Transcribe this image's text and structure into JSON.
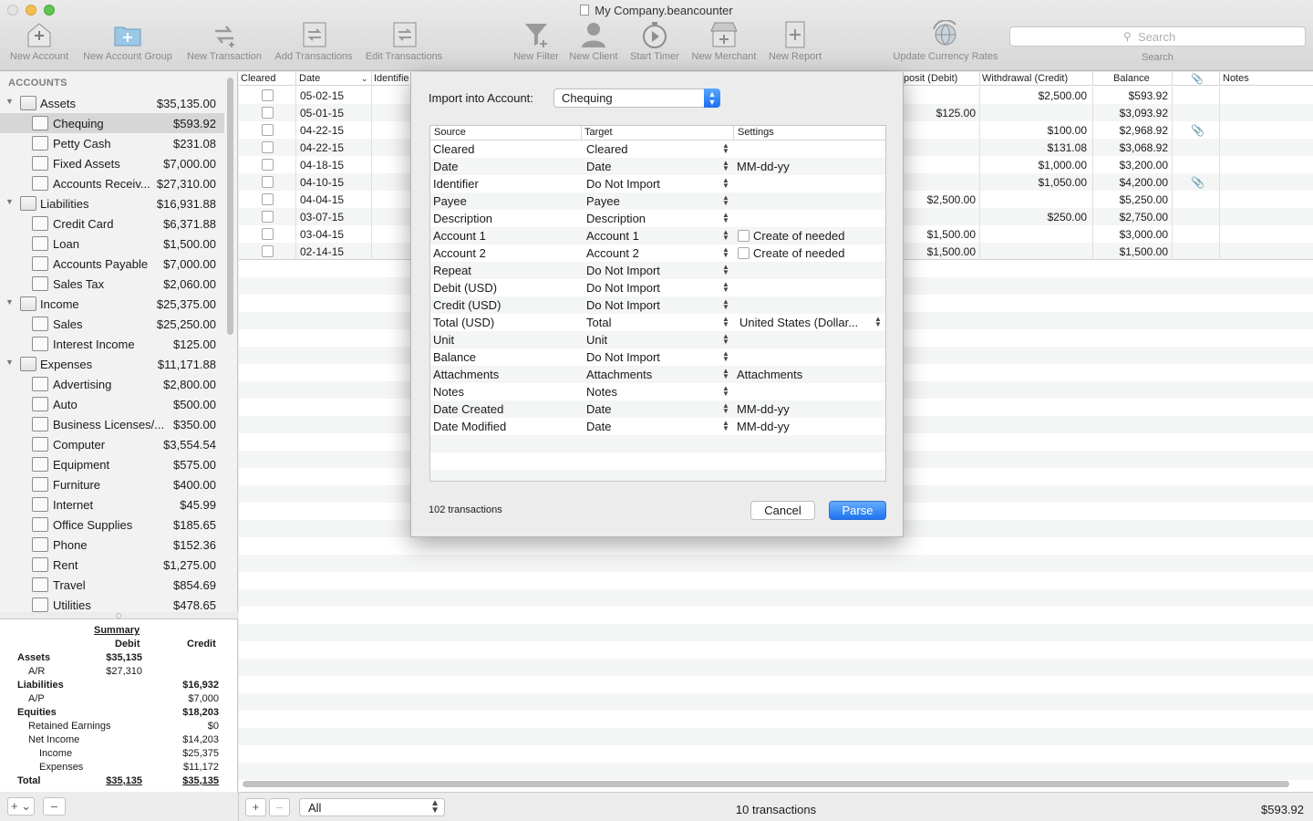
{
  "window": {
    "title": "My Company.beancounter"
  },
  "toolbar": {
    "items": [
      {
        "label": "New Account"
      },
      {
        "label": "New Account Group"
      },
      {
        "label": "New Transaction"
      },
      {
        "label": "Add Transactions"
      },
      {
        "label": "Edit Transactions"
      },
      {
        "label": "New Filter"
      },
      {
        "label": "New Client"
      },
      {
        "label": "Start Timer"
      },
      {
        "label": "New Merchant"
      },
      {
        "label": "New Report"
      },
      {
        "label": "Update Currency Rates"
      }
    ],
    "search": {
      "placeholder": "Search",
      "label": "Search"
    }
  },
  "sidebar": {
    "header": "ACCOUNTS",
    "accounts": [
      {
        "name": "Assets",
        "balance": "$35,135.00"
      },
      {
        "name": "Chequing",
        "balance": "$593.92"
      },
      {
        "name": "Petty Cash",
        "balance": "$231.08"
      },
      {
        "name": "Fixed Assets",
        "balance": "$7,000.00"
      },
      {
        "name": "Accounts Receiv...",
        "balance": "$27,310.00"
      },
      {
        "name": "Liabilities",
        "balance": "$16,931.88"
      },
      {
        "name": "Credit Card",
        "balance": "$6,371.88"
      },
      {
        "name": "Loan",
        "balance": "$1,500.00"
      },
      {
        "name": "Accounts Payable",
        "balance": "$7,000.00"
      },
      {
        "name": "Sales Tax",
        "balance": "$2,060.00"
      },
      {
        "name": "Income",
        "balance": "$25,375.00"
      },
      {
        "name": "Sales",
        "balance": "$25,250.00"
      },
      {
        "name": "Interest Income",
        "balance": "$125.00"
      },
      {
        "name": "Expenses",
        "balance": "$11,171.88"
      },
      {
        "name": "Advertising",
        "balance": "$2,800.00"
      },
      {
        "name": "Auto",
        "balance": "$500.00"
      },
      {
        "name": "Business Licenses/...",
        "balance": "$350.00"
      },
      {
        "name": "Computer",
        "balance": "$3,554.54"
      },
      {
        "name": "Equipment",
        "balance": "$575.00"
      },
      {
        "name": "Furniture",
        "balance": "$400.00"
      },
      {
        "name": "Internet",
        "balance": "$45.99"
      },
      {
        "name": "Office Supplies",
        "balance": "$185.65"
      },
      {
        "name": "Phone",
        "balance": "$152.36"
      },
      {
        "name": "Rent",
        "balance": "$1,275.00"
      },
      {
        "name": "Travel",
        "balance": "$854.69"
      },
      {
        "name": "Utilities",
        "balance": "$478.65"
      }
    ]
  },
  "summary": {
    "title": "Summary",
    "debit_header": "Debit",
    "credit_header": "Credit",
    "rows": [
      {
        "label": "Assets",
        "debit": "$35,135",
        "credit": ""
      },
      {
        "label": "A/R",
        "debit": "$27,310",
        "credit": ""
      },
      {
        "label": "Liabilities",
        "debit": "",
        "credit": "$16,932"
      },
      {
        "label": "A/P",
        "debit": "",
        "credit": "$7,000"
      },
      {
        "label": "Equities",
        "debit": "",
        "credit": "$18,203"
      },
      {
        "label": "Retained Earnings",
        "debit": "",
        "credit": "$0"
      },
      {
        "label": "Net Income",
        "debit": "",
        "credit": "$14,203"
      },
      {
        "label": "Income",
        "debit": "",
        "credit": "$25,375"
      },
      {
        "label": "Expenses",
        "debit": "",
        "credit": "$11,172"
      },
      {
        "label": "Total",
        "debit": "$35,135",
        "credit": "$35,135"
      }
    ]
  },
  "register": {
    "columns": {
      "cleared": "Cleared",
      "date": "Date",
      "identifier": "Identifie",
      "deposit": "posit (Debit)",
      "withdrawal": "Withdrawal (Credit)",
      "balance": "Balance",
      "notes": "Notes"
    },
    "rows": [
      {
        "date": "05-02-15",
        "deposit": "",
        "withdrawal": "$2,500.00",
        "balance": "$593.92",
        "attachment": false
      },
      {
        "date": "05-01-15",
        "deposit": "$125.00",
        "withdrawal": "",
        "balance": "$3,093.92",
        "attachment": false
      },
      {
        "date": "04-22-15",
        "deposit": "",
        "withdrawal": "$100.00",
        "balance": "$2,968.92",
        "attachment": true
      },
      {
        "date": "04-22-15",
        "deposit": "",
        "withdrawal": "$131.08",
        "balance": "$3,068.92",
        "attachment": false
      },
      {
        "date": "04-18-15",
        "deposit": "",
        "withdrawal": "$1,000.00",
        "balance": "$3,200.00",
        "attachment": false
      },
      {
        "date": "04-10-15",
        "deposit": "",
        "withdrawal": "$1,050.00",
        "balance": "$4,200.00",
        "attachment": true
      },
      {
        "date": "04-04-15",
        "deposit": "$2,500.00",
        "withdrawal": "",
        "balance": "$5,250.00",
        "attachment": false
      },
      {
        "date": "03-07-15",
        "deposit": "",
        "withdrawal": "$250.00",
        "balance": "$2,750.00",
        "attachment": false
      },
      {
        "date": "03-04-15",
        "deposit": "$1,500.00",
        "withdrawal": "",
        "balance": "$3,000.00",
        "attachment": false
      },
      {
        "date": "02-14-15",
        "deposit": "$1,500.00",
        "withdrawal": "",
        "balance": "$1,500.00",
        "attachment": false
      }
    ]
  },
  "bottom_bar": {
    "filter_value": "All",
    "transaction_count": "10 transactions",
    "balance": "$593.92"
  },
  "import_dialog": {
    "import_label": "Import into Account:",
    "account": "Chequing",
    "headers": {
      "source": "Source",
      "target": "Target",
      "settings": "Settings"
    },
    "rows": [
      {
        "source": "Cleared",
        "target": "Cleared",
        "settings": "",
        "kind": "none"
      },
      {
        "source": "Date",
        "target": "Date",
        "settings": "MM-dd-yy",
        "kind": "text"
      },
      {
        "source": "Identifier",
        "target": "Do Not Import",
        "settings": "",
        "kind": "none"
      },
      {
        "source": "Payee",
        "target": "Payee",
        "settings": "",
        "kind": "none"
      },
      {
        "source": "Description",
        "target": "Description",
        "settings": "",
        "kind": "none"
      },
      {
        "source": "Account 1",
        "target": "Account 1",
        "settings": "Create of needed",
        "kind": "checkbox"
      },
      {
        "source": "Account 2",
        "target": "Account 2",
        "settings": "Create of needed",
        "kind": "checkbox"
      },
      {
        "source": "Repeat",
        "target": "Do Not Import",
        "settings": "",
        "kind": "none"
      },
      {
        "source": "Debit (USD)",
        "target": "Do Not Import",
        "settings": "",
        "kind": "none"
      },
      {
        "source": "Credit (USD)",
        "target": "Do Not Import",
        "settings": "",
        "kind": "none"
      },
      {
        "source": "Total (USD)",
        "target": "Total",
        "settings": "United States (Dollar...",
        "kind": "popup"
      },
      {
        "source": "Unit",
        "target": "Unit",
        "settings": "",
        "kind": "none"
      },
      {
        "source": "Balance",
        "target": "Do Not Import",
        "settings": "",
        "kind": "none"
      },
      {
        "source": "Attachments",
        "target": "Attachments",
        "settings": "Attachments",
        "kind": "text"
      },
      {
        "source": "Notes",
        "target": "Notes",
        "settings": "",
        "kind": "none"
      },
      {
        "source": "Date Created",
        "target": "Date",
        "settings": "MM-dd-yy",
        "kind": "text"
      },
      {
        "source": "Date Modified",
        "target": "Date",
        "settings": "MM-dd-yy",
        "kind": "text"
      }
    ],
    "transaction_count": "102 transactions",
    "cancel_label": "Cancel",
    "parse_label": "Parse"
  }
}
